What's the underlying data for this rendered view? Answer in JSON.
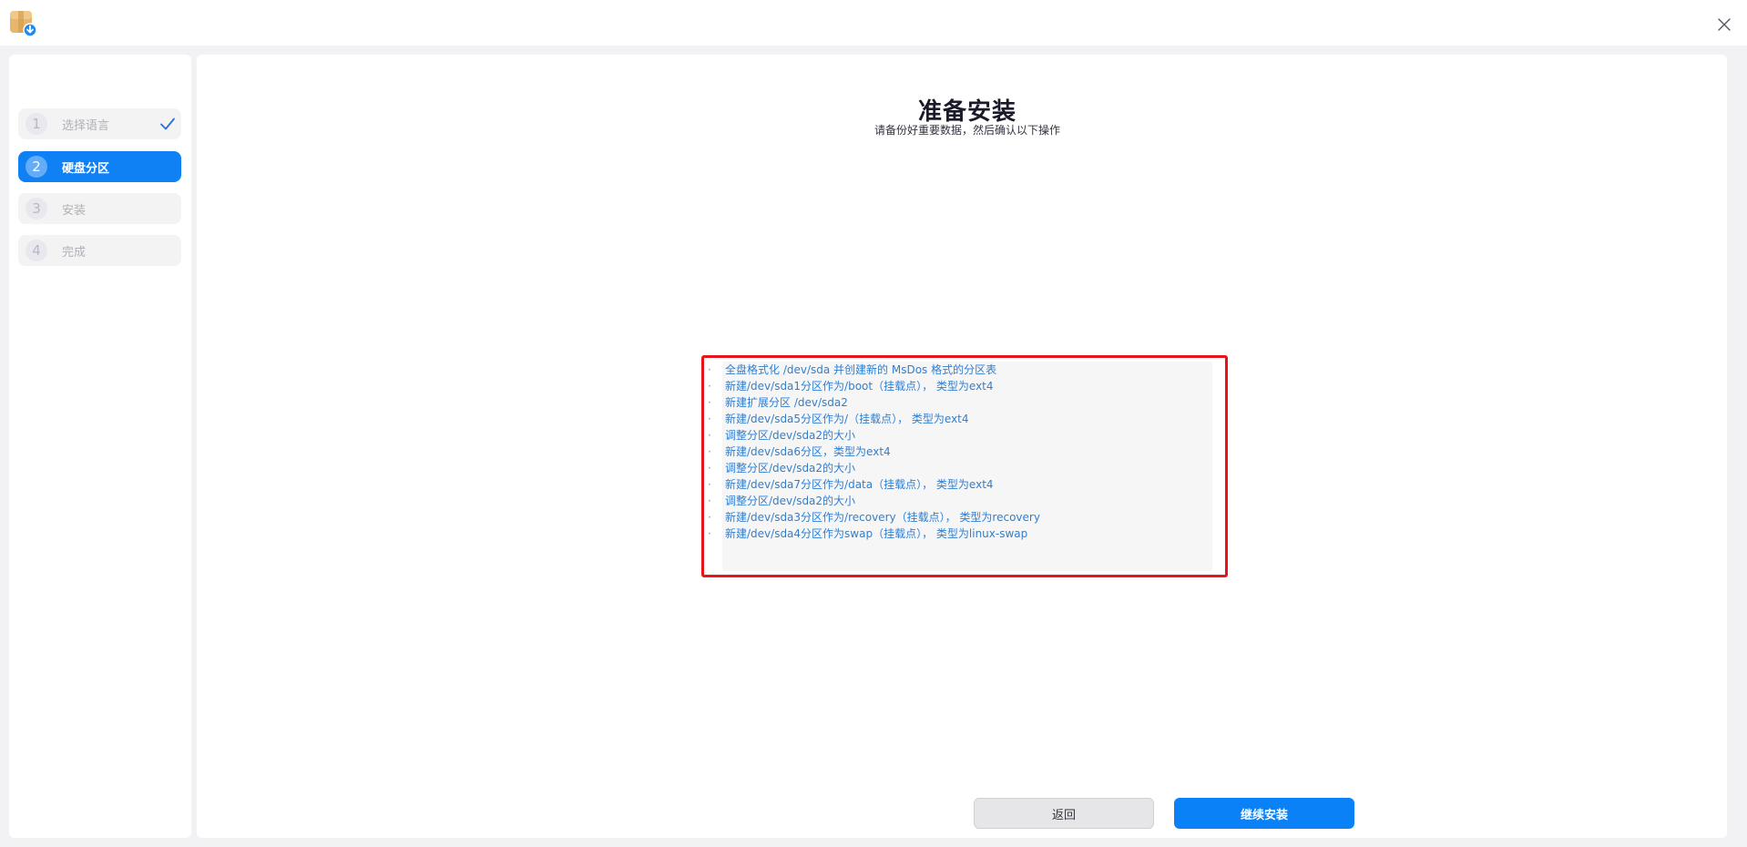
{
  "app": {
    "icon": "package-download-icon",
    "close_icon": "close-icon"
  },
  "sidebar": {
    "steps": [
      {
        "number": "1",
        "label": "选择语言",
        "state": "done"
      },
      {
        "number": "2",
        "label": "硬盘分区",
        "state": "active"
      },
      {
        "number": "3",
        "label": "安装",
        "state": "pending"
      },
      {
        "number": "4",
        "label": "完成",
        "state": "pending"
      }
    ]
  },
  "main": {
    "title": "准备安装",
    "subtitle": "请备份好重要数据，然后确认以下操作",
    "bullet": "·",
    "operations": [
      "全盘格式化 /dev/sda 并创建新的 MsDos 格式的分区表",
      "新建/dev/sda1分区作为/boot（挂载点）， 类型为ext4",
      "新建扩展分区 /dev/sda2",
      "新建/dev/sda5分区作为/（挂载点）， 类型为ext4",
      "调整分区/dev/sda2的大小",
      "新建/dev/sda6分区，类型为ext4",
      "调整分区/dev/sda2的大小",
      "新建/dev/sda7分区作为/data（挂载点）， 类型为ext4",
      "调整分区/dev/sda2的大小",
      "新建/dev/sda3分区作为/recovery（挂载点）， 类型为recovery",
      "新建/dev/sda4分区作为swap（挂载点）， 类型为linux-swap"
    ]
  },
  "buttons": {
    "back_label": "返回",
    "continue_label": "继续安装"
  },
  "colors": {
    "accent": "#1081f5",
    "highlight_border": "#e8141c",
    "operation_text": "#2f7fd1"
  }
}
